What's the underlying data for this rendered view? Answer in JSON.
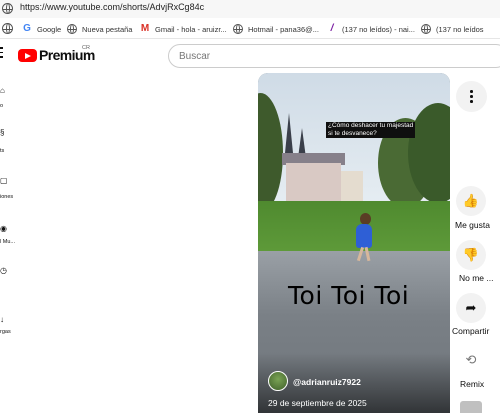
{
  "browser": {
    "url": "https://www.youtube.com/shorts/AdvjRxCg84c",
    "bookmarks": [
      {
        "label": "Google",
        "icon": "google-icon"
      },
      {
        "label": "Nueva pestaña",
        "icon": "globe-icon"
      },
      {
        "label": "Gmail - hola - aruizr...",
        "icon": "gmail-icon"
      },
      {
        "label": "Hotmail - pana36@...",
        "icon": "globe-icon"
      },
      {
        "label": "(137 no leídos) - nai...",
        "icon": "yahoo-icon"
      },
      {
        "label": "(137 no leídos",
        "icon": "globe-icon"
      }
    ]
  },
  "header": {
    "brand": "Premium",
    "region": "CR",
    "search_placeholder": "Buscar"
  },
  "sidebar": {
    "items": [
      {
        "label": "o",
        "icon": "home-icon"
      },
      {
        "label": "ts",
        "icon": "shorts-icon"
      },
      {
        "label": "iones",
        "icon": "subscriptions-icon"
      },
      {
        "label": "l Mu...",
        "icon": "music-icon"
      },
      {
        "label": "",
        "icon": "history-icon"
      },
      {
        "label": "rgas",
        "icon": "downloads-icon"
      }
    ]
  },
  "video": {
    "caption": "¿Cómo deshacer tu majestad\nsi te desvanece?",
    "overlay_text": "Toi Toi Toi",
    "channel": "@adrianruiz7922",
    "date": "29 de septiembre de 2025"
  },
  "actions": {
    "like": "Me gusta",
    "dislike": "No me ...",
    "share": "Compartir",
    "remix": "Remix"
  }
}
